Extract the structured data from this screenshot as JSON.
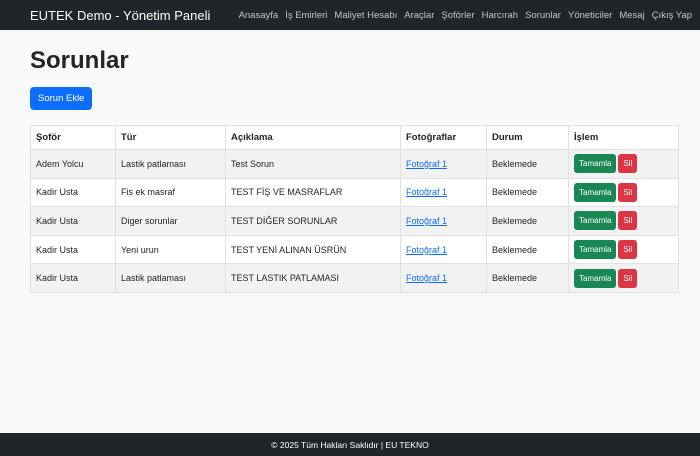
{
  "navbar": {
    "brand": "EUTEK Demo - Yönetim Paneli",
    "links": [
      "Anasayfa",
      "İş Emirleri",
      "Maliyet Hesabı",
      "Araçlar",
      "Şoförler",
      "Harcırah",
      "Sorunlar",
      "Yöneticiler",
      "Mesaj",
      "Çıkış Yap"
    ]
  },
  "page": {
    "title": "Sorunlar",
    "add_button": "Sorun Ekle"
  },
  "table": {
    "headers": [
      "Şoför",
      "Tür",
      "Açıklama",
      "Fotoğraflar",
      "Durum",
      "İşlem"
    ],
    "rows": [
      {
        "sofor": "Adem Yolcu",
        "tur": "Lastik patlaması",
        "aciklama": "Test Sorun",
        "foto": "Fotoğraf 1",
        "durum": "Beklemede",
        "complete": "Tamamla",
        "delete": "Sil"
      },
      {
        "sofor": "Kadir Usta",
        "tur": "Fis ek masraf",
        "aciklama": "TEST FİŞ VE MASRAFLAR",
        "foto": "Fotoğraf 1",
        "durum": "Beklemede",
        "complete": "Tamamla",
        "delete": "Sil"
      },
      {
        "sofor": "Kadir Usta",
        "tur": "Diger sorunlar",
        "aciklama": "TEST DİĞER SORUNLAR",
        "foto": "Fotoğraf 1",
        "durum": "Beklemede",
        "complete": "Tamamla",
        "delete": "Sil"
      },
      {
        "sofor": "Kadir Usta",
        "tur": "Yeni urun",
        "aciklama": "TEST YENİ ALINAN ÜSRÜN",
        "foto": "Fotoğraf 1",
        "durum": "Beklemede",
        "complete": "Tamamla",
        "delete": "Sil"
      },
      {
        "sofor": "Kadir Usta",
        "tur": "Lastik patlaması",
        "aciklama": "TEST LASTIK PATLAMASI",
        "foto": "Fotoğraf 1",
        "durum": "Beklemede",
        "complete": "Tamamla",
        "delete": "Sil"
      }
    ]
  },
  "footer": {
    "text": "© 2025 Tüm Hakları Saklıdır | EU TEKNO"
  },
  "colors": {
    "navbar_bg": "#212529",
    "primary": "#0d6efd",
    "success": "#198754",
    "danger": "#dc3545"
  }
}
